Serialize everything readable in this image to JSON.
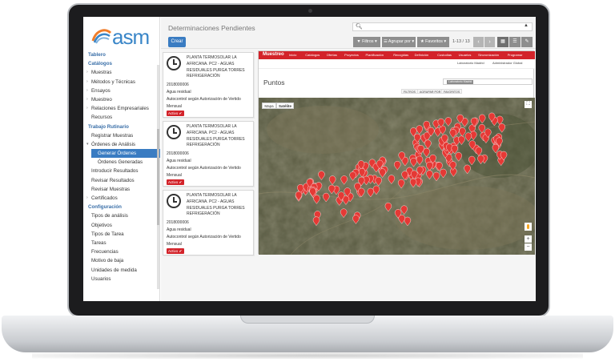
{
  "logo": {
    "text": "asm"
  },
  "nav": {
    "items": [
      {
        "label": "Tablero",
        "kind": "section"
      },
      {
        "label": "Catálogos",
        "kind": "section"
      },
      {
        "label": "Muestras",
        "kind": "expandable"
      },
      {
        "label": "Métodos y Técnicas",
        "kind": "expandable"
      },
      {
        "label": "Ensayos",
        "kind": "expandable"
      },
      {
        "label": "Muestreo",
        "kind": "expandable"
      },
      {
        "label": "Relaciones Empresariales",
        "kind": "expandable"
      },
      {
        "label": "Recursos",
        "kind": "sub"
      },
      {
        "label": "Trabajo Rutinario",
        "kind": "section"
      },
      {
        "label": "Registrar Muestras",
        "kind": "sub"
      },
      {
        "label": "Órdenes de Análisis",
        "kind": "expanded"
      },
      {
        "label": "Generar Órdenes",
        "kind": "active"
      },
      {
        "label": "Órdenes Generadas",
        "kind": "subsub"
      },
      {
        "label": "Introducir Resultados",
        "kind": "sub"
      },
      {
        "label": "Revisar Resultados",
        "kind": "sub"
      },
      {
        "label": "Revisar Muestras",
        "kind": "sub"
      },
      {
        "label": "Certificados",
        "kind": "expandable"
      },
      {
        "label": "Configuración",
        "kind": "section"
      },
      {
        "label": "Tipos de análisis",
        "kind": "sub"
      },
      {
        "label": "Objetivos",
        "kind": "sub"
      },
      {
        "label": "Tipos de Tarea",
        "kind": "sub"
      },
      {
        "label": "Tareas",
        "kind": "sub"
      },
      {
        "label": "Frecuencias",
        "kind": "sub"
      },
      {
        "label": "Motivo de baja",
        "kind": "sub"
      },
      {
        "label": "Unidades de medida",
        "kind": "sub"
      },
      {
        "label": "Usuarios",
        "kind": "sub"
      }
    ]
  },
  "topbar": {
    "title": "Determinaciones Pendientes",
    "create_label": "Crear",
    "filters_label": "Filtros",
    "group_label": "Agrupar por",
    "favorites_label": "Favoritos",
    "pager": "1-13 / 13",
    "prev": "‹",
    "next": "›"
  },
  "cards": [
    {
      "title": "PLANTA TERMOSOLAR LA AFRICANA. PC2 - AGUAS RESIDUALES PURGA TORRES REFRIGERACIÓN",
      "code": "2018000006",
      "matrix": "Agua residual",
      "note": "Autocontrol según Autorización de Vertido",
      "freq": "Mensual",
      "status": "Activo"
    },
    {
      "title": "PLANTA TERMOSOLAR LA AFRICANA. PC2 - AGUAS RESIDUALES PURGA TORRES REFRIGERACIÓN",
      "code": "2018000006",
      "matrix": "Agua residual",
      "note": "Autocontrol según Autorización de Vertido",
      "freq": "Mensual",
      "status": "Activo"
    },
    {
      "title": "PLANTA TERMOSOLAR LA AFRICANA. PC2 - AGUAS RESIDUALES PURGA TORRES REFRIGERACIÓN",
      "code": "2018000006",
      "matrix": "Agua residual",
      "note": "Autocontrol según Autorización de Vertido",
      "freq": "Mensual",
      "status": "Activo"
    }
  ],
  "inner": {
    "brand": "Muestreo",
    "menu": [
      "Inicio",
      "Catálogos",
      "Ofertas",
      "Proyectos",
      "Planificación",
      "Recogidas",
      "Definición",
      "Custodias",
      "Usuarios",
      "Sincronización",
      "Programar"
    ],
    "user": "Administrador Global",
    "company": "Laboratorio Madrid",
    "title": "Puntos",
    "search_chip": "Laboratorio Madrid",
    "tools": [
      "FILTROS",
      "AGRUPAR POR",
      "FAVORITOS"
    ],
    "map_tabs": [
      "Mapa",
      "Satélite"
    ],
    "zoom_in": "+",
    "zoom_out": "−",
    "marker_color": "#e53935"
  },
  "colors": {
    "accent": "#3a7cc2",
    "brand_red": "#d3232a"
  }
}
